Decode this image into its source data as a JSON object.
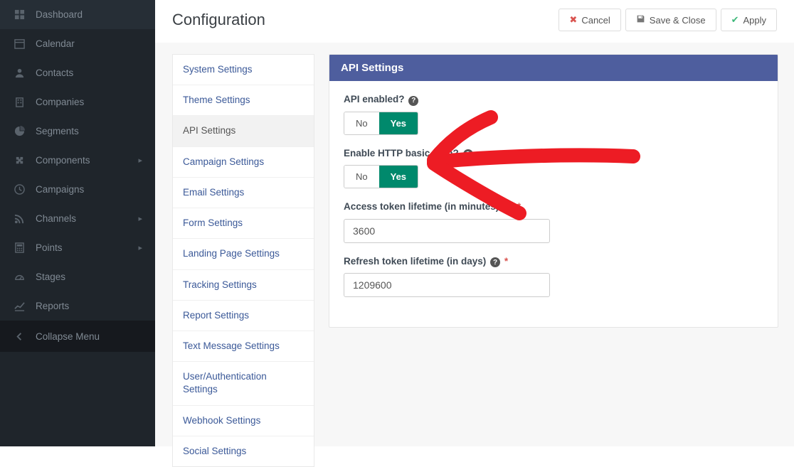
{
  "sidebar": {
    "items": [
      {
        "label": "Dashboard",
        "icon": "grid",
        "expandable": false
      },
      {
        "label": "Calendar",
        "icon": "calendar",
        "expandable": false
      },
      {
        "label": "Contacts",
        "icon": "user",
        "expandable": false
      },
      {
        "label": "Companies",
        "icon": "building",
        "expandable": false
      },
      {
        "label": "Segments",
        "icon": "pie",
        "expandable": false
      },
      {
        "label": "Components",
        "icon": "puzzle",
        "expandable": true
      },
      {
        "label": "Campaigns",
        "icon": "clock",
        "expandable": false
      },
      {
        "label": "Channels",
        "icon": "rss",
        "expandable": true
      },
      {
        "label": "Points",
        "icon": "calc",
        "expandable": true
      },
      {
        "label": "Stages",
        "icon": "gauge",
        "expandable": false
      },
      {
        "label": "Reports",
        "icon": "chart",
        "expandable": false
      }
    ],
    "collapse_label": "Collapse Menu"
  },
  "header": {
    "title": "Configuration",
    "cancel": "Cancel",
    "save_close": "Save & Close",
    "apply": "Apply"
  },
  "settings_nav": [
    "System Settings",
    "Theme Settings",
    "API Settings",
    "Campaign Settings",
    "Email Settings",
    "Form Settings",
    "Landing Page Settings",
    "Tracking Settings",
    "Report Settings",
    "Text Message Settings",
    "User/Authentication Settings",
    "Webhook Settings",
    "Social Settings"
  ],
  "settings_nav_active_index": 2,
  "panel": {
    "title": "API Settings",
    "fields": {
      "api_enabled": {
        "label": "API enabled?",
        "no": "No",
        "yes": "Yes",
        "value": "Yes"
      },
      "basic_auth": {
        "label": "Enable HTTP basic auth?",
        "no": "No",
        "yes": "Yes",
        "value": "Yes"
      },
      "access_token": {
        "label": "Access token lifetime (in minutes)",
        "value": "3600",
        "required": true
      },
      "refresh_token": {
        "label": "Refresh token lifetime (in days)",
        "value": "1209600",
        "required": true
      }
    }
  }
}
